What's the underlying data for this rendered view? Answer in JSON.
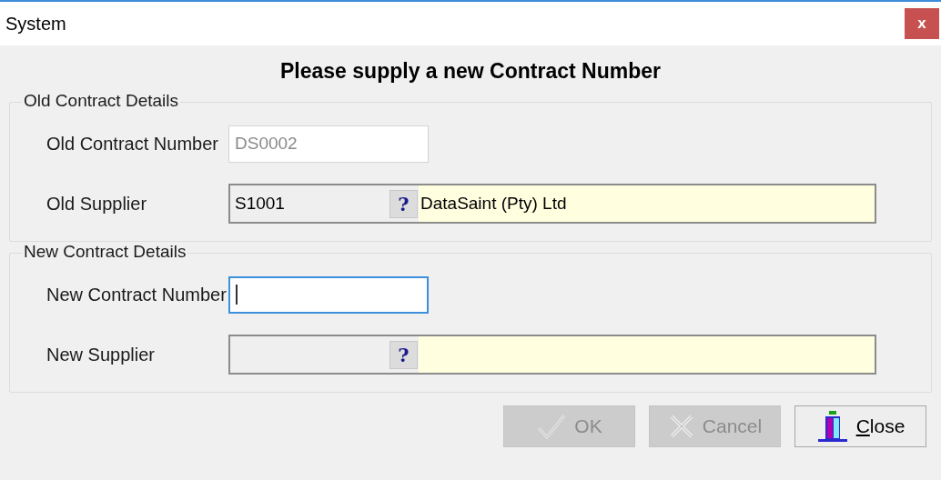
{
  "window": {
    "title": "System",
    "close_glyph": "x"
  },
  "heading": "Please supply a new Contract Number",
  "groups": [
    {
      "title": "Old Contract Details",
      "rows": [
        {
          "kind": "text",
          "label": "Old Contract Number",
          "value": "DS0002",
          "disabled": true,
          "focused": false
        },
        {
          "kind": "lookup",
          "label": "Old Supplier",
          "code": "S1001",
          "lookup_glyph": "?",
          "name": "DataSaint (Pty) Ltd"
        }
      ]
    },
    {
      "title": "New Contract Details",
      "rows": [
        {
          "kind": "text",
          "label": "New Contract Number",
          "disabled": false,
          "focused": true
        },
        {
          "kind": "lookup",
          "label": "New Supplier",
          "lookup_glyph": "?"
        }
      ]
    }
  ],
  "buttons": [
    {
      "kind": "ok",
      "label": "OK",
      "disabled": true
    },
    {
      "kind": "cancel",
      "label": "Cancel",
      "disabled": true
    },
    {
      "kind": "close",
      "label": "Close",
      "disabled": false,
      "first_letter_underlined": true
    }
  ]
}
